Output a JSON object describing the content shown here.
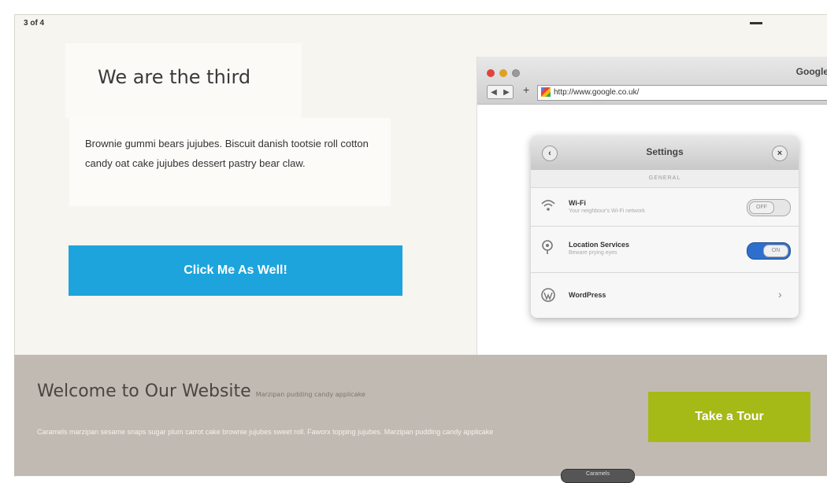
{
  "slider": {
    "counter": "3 of 4"
  },
  "hero": {
    "title": "We are the third",
    "text": "Brownie gummi bears jujubes. Biscuit danish tootsie roll cotton candy oat cake jujubes dessert pastry bear claw.",
    "button_label": "Click Me As Well!"
  },
  "browser": {
    "title": "Google",
    "url": "http://www.google.co.uk/",
    "back_glyph": "◀",
    "forward_glyph": "▶",
    "plus_glyph": "+"
  },
  "settings": {
    "back_glyph": "‹",
    "close_glyph": "×",
    "title": "Settings",
    "section": "GENERAL",
    "rows": [
      {
        "label": "Wi-Fi",
        "sub": "Your neighbour's Wi-Fi network",
        "toggle": "OFF",
        "icon": "wifi-icon"
      },
      {
        "label": "Location Services",
        "sub": "Beware prying eyes",
        "toggle": "ON",
        "icon": "location-icon"
      },
      {
        "label": "WordPress",
        "chevron": "›",
        "icon": "wordpress-icon"
      }
    ]
  },
  "band": {
    "title": "Welcome to Our Website",
    "subtitle": "Marzipan pudding candy applicake",
    "text": "Caramels marzipan sesame snaps sugar plum carrot cake brownie jujubes sweet roll. Faworx topping jujubes. Marzipan pudding candy applicake",
    "button_label": "Take a Tour",
    "pill_label": "Caramels"
  },
  "colors": {
    "cta": "#1da4dc",
    "tour": "#a5b917",
    "band": "#c1bab2"
  }
}
